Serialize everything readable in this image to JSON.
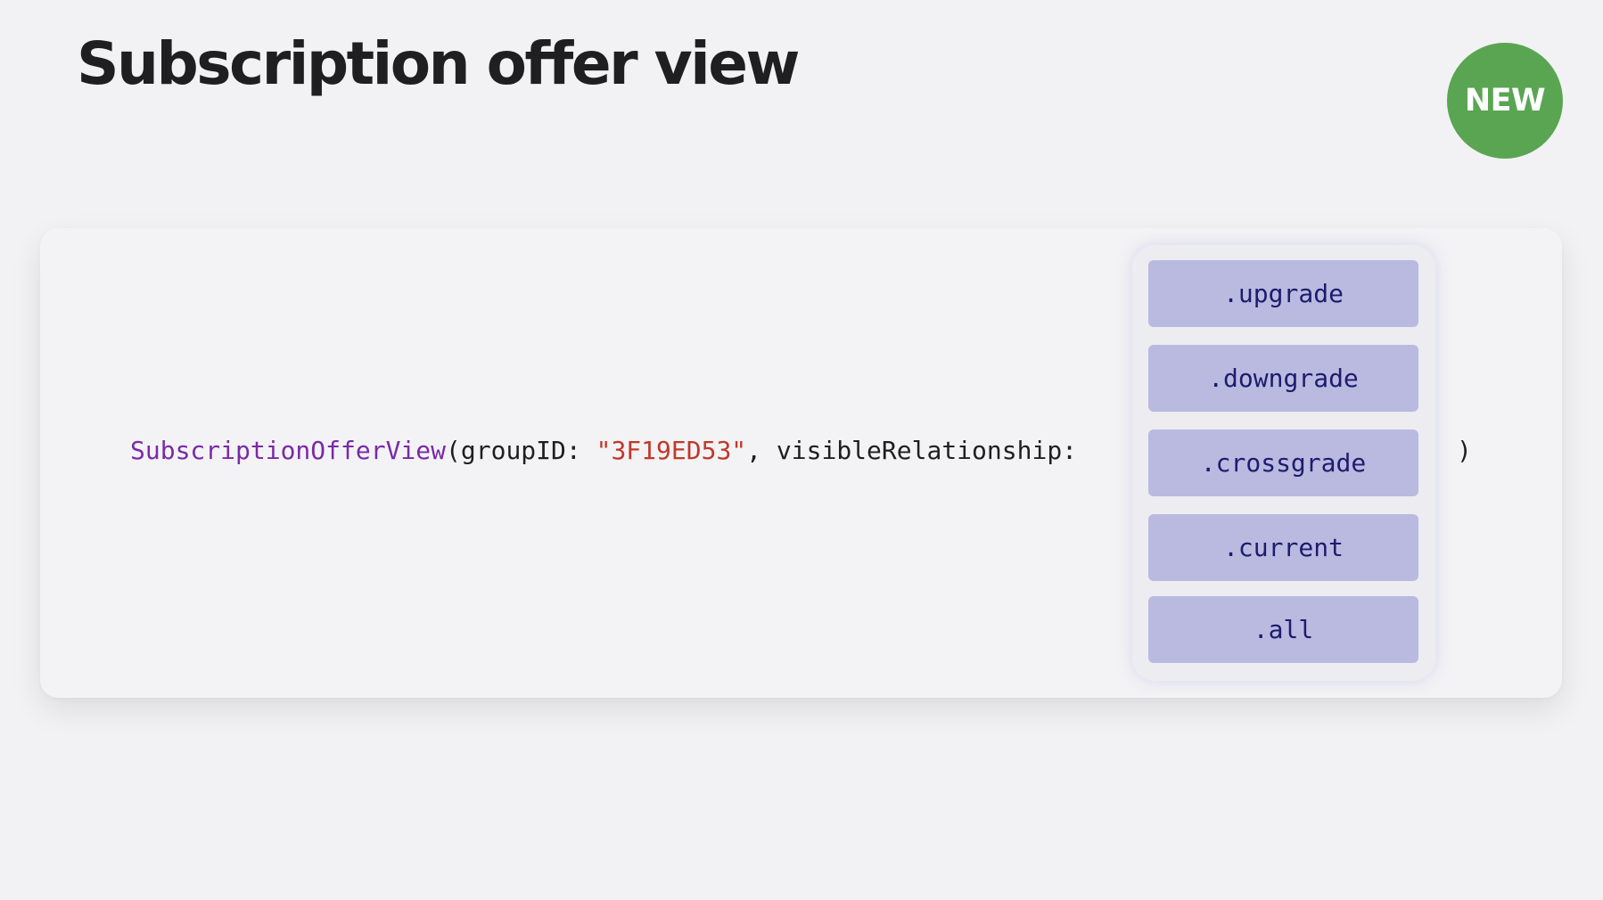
{
  "title": "Subscription offer view",
  "badge": "NEW",
  "code": {
    "type_name": "SubscriptionOfferView",
    "open_paren_arg": "(groupID: ",
    "group_id_string": "\"3F19ED53\"",
    "separator_arg": ", visibleRelationship:",
    "close_paren": ")"
  },
  "options": [
    ".upgrade",
    ".downgrade",
    ".crossgrade",
    ".current",
    ".all"
  ],
  "colors": {
    "background": "#f2f2f4",
    "badge": "#5aa552",
    "type_token": "#7a2aa6",
    "string_token": "#c0392b",
    "option_fill": "#babae0",
    "option_text": "#1c1c6e"
  }
}
